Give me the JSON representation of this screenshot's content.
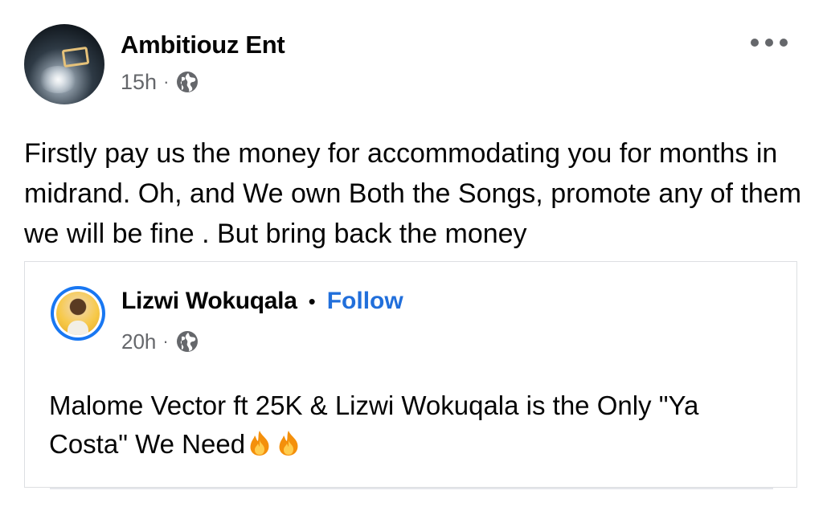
{
  "post": {
    "author": "Ambitiouz Ent",
    "time": "15h",
    "separator": "·",
    "text": "Firstly pay us the money for accommodating you for months in midrand. Oh, and We own Both the Songs, promote any of them we will be fine . But bring back the money"
  },
  "shared": {
    "author": "Lizwi Wokuqala",
    "bullet": "•",
    "follow_label": "Follow",
    "time": "20h",
    "separator": "·",
    "text": "Malome Vector ft 25K & Lizwi Wokuqala is the Only \"Ya Costa\" We Need"
  },
  "icons": {
    "more": "more-options-icon",
    "globe": "globe-icon",
    "fire": "fire-emoji-icon"
  },
  "colors": {
    "link": "#216fdb",
    "meta": "#65676b",
    "text": "#050505",
    "border": "#dddfe2"
  }
}
